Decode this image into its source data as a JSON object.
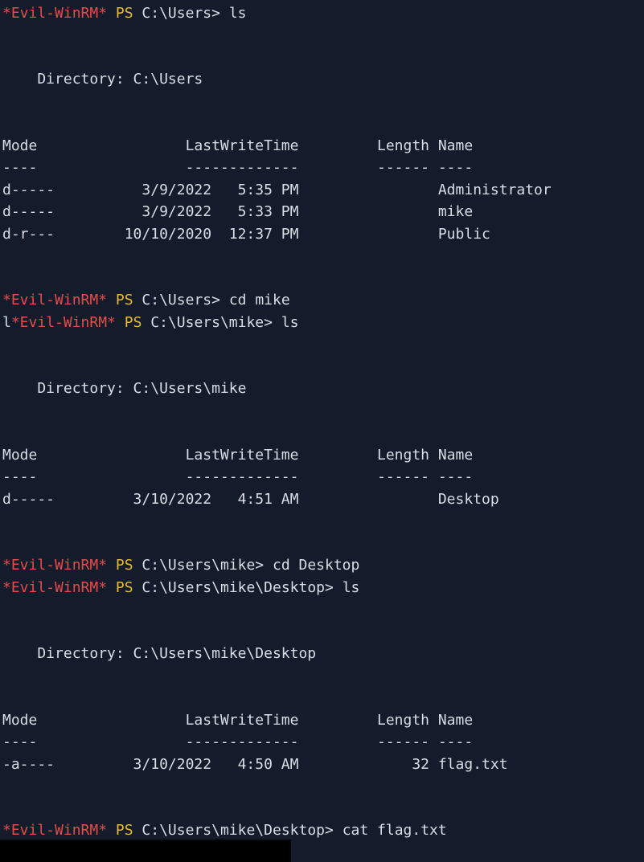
{
  "theme": {
    "background": "#141c2b",
    "text": "#d8dde6",
    "prompt_red": "#e64b4b",
    "prompt_yellow": "#e8ba2c",
    "redaction": "#000000"
  },
  "prompt": {
    "shell": "*Evil-WinRM*",
    "ps": "PS"
  },
  "blocks": [
    {
      "cmd1": {
        "path": "C:\\Users>",
        "command": "ls"
      },
      "directory_line": "    Directory: C:\\Users",
      "header": "Mode                 LastWriteTime         Length Name",
      "underline": "----                 -------------         ------ ----",
      "rows": [
        "d-----          3/9/2022   5:35 PM                Administrator",
        "d-----          3/9/2022   5:33 PM                mike",
        "d-r---        10/10/2020  12:37 PM                Public"
      ]
    },
    {
      "cmd1": {
        "path": "C:\\Users>",
        "command": "cd mike"
      },
      "cmd2": {
        "prefix": "l",
        "path": "C:\\Users\\mike>",
        "command": "ls"
      },
      "directory_line": "    Directory: C:\\Users\\mike",
      "header": "Mode                 LastWriteTime         Length Name",
      "underline": "----                 -------------         ------ ----",
      "rows": [
        "d-----         3/10/2022   4:51 AM                Desktop"
      ]
    },
    {
      "cmd1": {
        "path": "C:\\Users\\mike>",
        "command": "cd Desktop"
      },
      "cmd2": {
        "path": "C:\\Users\\mike\\Desktop>",
        "command": "ls"
      },
      "directory_line": "    Directory: C:\\Users\\mike\\Desktop",
      "header": "Mode                 LastWriteTime         Length Name",
      "underline": "----                 -------------         ------ ----",
      "rows": [
        "-a----         3/10/2022   4:50 AM             32 flag.txt"
      ]
    }
  ],
  "final_cmd": {
    "path": "C:\\Users\\mike\\Desktop>",
    "command": "cat flag.txt"
  }
}
